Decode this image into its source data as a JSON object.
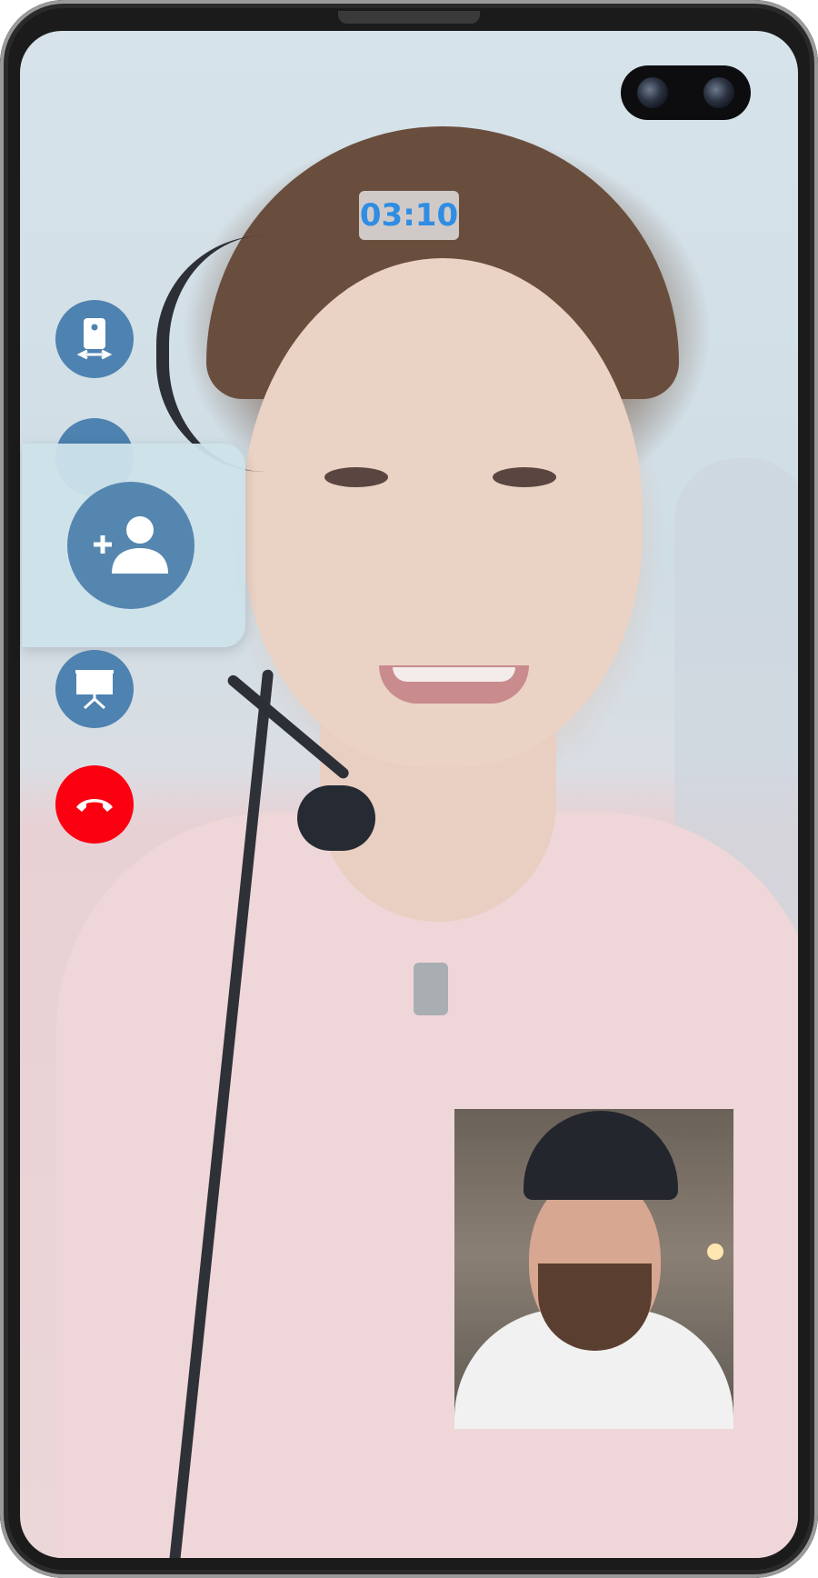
{
  "call": {
    "timer": "03:10"
  },
  "controls": {
    "switch_camera_icon": "switch-camera-icon",
    "add_participant_icon": "add-person-icon",
    "present_icon": "presentation-icon",
    "end_call_icon": "phone-hangup-icon"
  },
  "colors": {
    "control_bg": "#4e82b0",
    "end_call_bg": "#fb0011",
    "timer_text": "#2f8de4"
  }
}
